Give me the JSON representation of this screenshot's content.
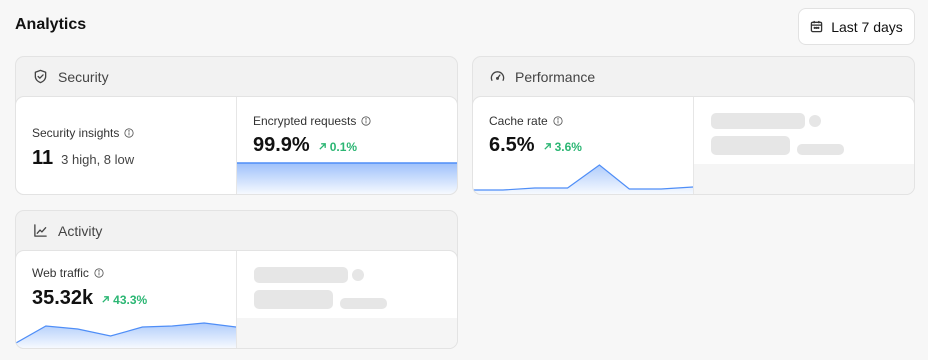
{
  "header": {
    "title": "Analytics",
    "date_range": "Last 7 days",
    "date_icon": "calendar-icon"
  },
  "colors": {
    "accent": "#4f8ef7",
    "positive": "#2bb673"
  },
  "security": {
    "title": "Security",
    "icon": "shield-icon",
    "insights": {
      "label": "Security insights",
      "value": "11",
      "detail": "3 high, 8 low"
    },
    "encrypted": {
      "label": "Encrypted requests",
      "value": "99.9%",
      "change": "0.1%"
    }
  },
  "performance": {
    "title": "Performance",
    "icon": "gauge-icon",
    "cache": {
      "label": "Cache rate",
      "value": "6.5%",
      "change": "3.6%"
    }
  },
  "activity": {
    "title": "Activity",
    "icon": "line-chart-icon",
    "traffic": {
      "label": "Web traffic",
      "value": "35.32k",
      "change": "43.3%"
    }
  }
}
